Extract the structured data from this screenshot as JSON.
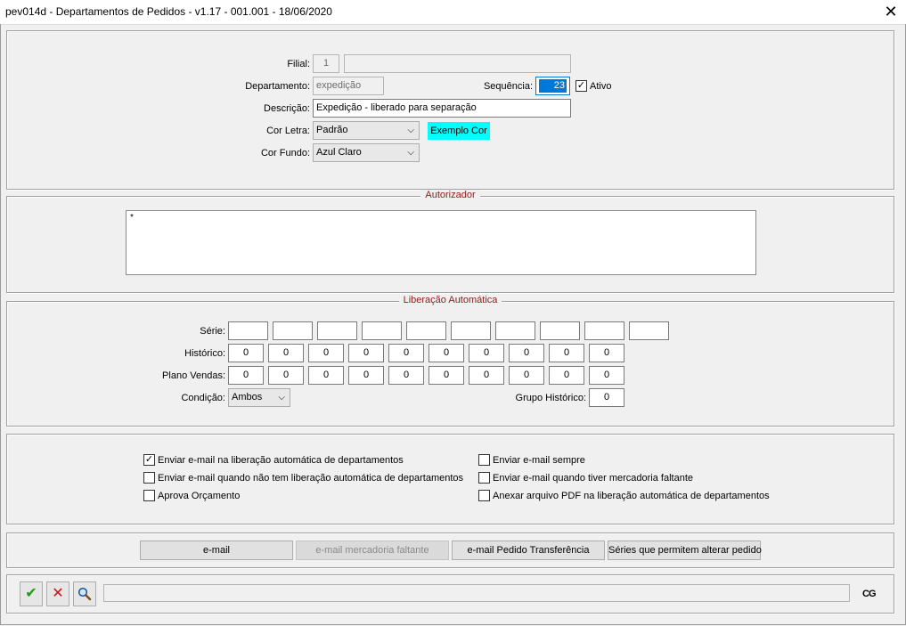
{
  "window": {
    "title": "pev014d - Departamentos de Pedidos - v1.17 - 001.001 - 18/06/2020"
  },
  "form": {
    "filial_label": "Filial:",
    "filial_value": "1",
    "filial_desc": "",
    "departamento_label": "Departamento:",
    "departamento_value": "expedição",
    "sequencia_label": "Sequência:",
    "sequencia_value": "23",
    "ativo_label": "Ativo",
    "descricao_label": "Descrição:",
    "descricao_value": "Expedição - liberado para separação",
    "cor_letra_label": "Cor Letra:",
    "cor_letra_value": "Padrão",
    "exemplo_cor": "Exemplo Cor",
    "cor_fundo_label": "Cor Fundo:",
    "cor_fundo_value": "Azul Claro"
  },
  "autorizador": {
    "title": "Autorizador",
    "content": "*"
  },
  "liberacao": {
    "title": "Liberação Automática",
    "serie_label": "Série:",
    "historico_label": "Histórico:",
    "plano_label": "Plano Vendas:",
    "condicao_label": "Condição:",
    "condicao_value": "Ambos",
    "grupo_label": "Grupo Histórico:",
    "grupo_value": "0",
    "serie_values": [
      "",
      "",
      "",
      "",
      "",
      "",
      "",
      "",
      "",
      ""
    ],
    "historico_values": [
      "0",
      "0",
      "0",
      "0",
      "0",
      "0",
      "0",
      "0",
      "0",
      "0"
    ],
    "plano_values": [
      "0",
      "0",
      "0",
      "0",
      "0",
      "0",
      "0",
      "0",
      "0",
      "0"
    ]
  },
  "options": {
    "enviar_liberacao": "Enviar e-mail na liberação automática de departamentos",
    "enviar_sem_liberacao": "Enviar e-mail quando não tem liberação automática de departamentos",
    "aprova_orcamento": "Aprova Orçamento",
    "enviar_sempre": "Enviar e-mail sempre",
    "enviar_faltante": "Enviar e-mail quando tiver mercadoria faltante",
    "anexar_pdf": "Anexar arquivo PDF na liberação automática de departamentos"
  },
  "buttons": {
    "email": "e-mail",
    "email_faltante": "e-mail mercadoria faltante",
    "email_transferencia": "e-mail Pedido Transferência",
    "series": "Séries que permitem alterar pedido"
  },
  "footer": {
    "status": "",
    "logo": "CG"
  },
  "colors": {
    "exemplo_bg": "#00ffff",
    "legend": "#8b1a1a",
    "seq_highlight": "#0078d7"
  },
  "icons": {
    "confirm": "check-icon",
    "cancel": "x-icon",
    "search": "magnifier-icon"
  }
}
